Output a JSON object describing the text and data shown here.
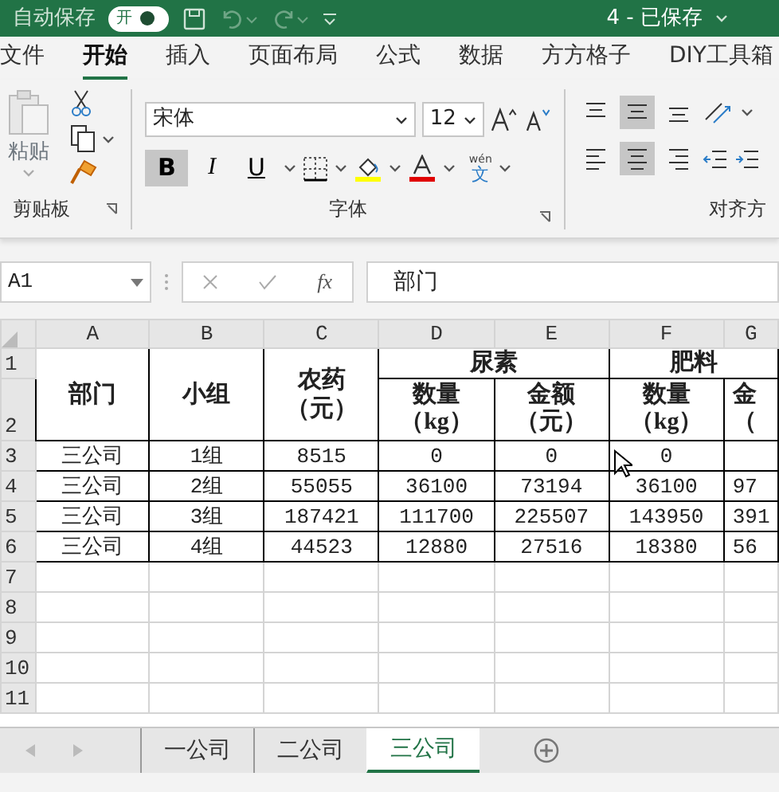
{
  "title_bar": {
    "autosave_label": "自动保存",
    "autosave_toggle": {
      "label": "开",
      "on": true
    },
    "document_title": "4 - 已保存"
  },
  "menu_tabs": [
    {
      "label": "文件",
      "selected": false
    },
    {
      "label": "开始",
      "selected": true
    },
    {
      "label": "插入",
      "selected": false
    },
    {
      "label": "页面布局",
      "selected": false
    },
    {
      "label": "公式",
      "selected": false
    },
    {
      "label": "数据",
      "selected": false
    },
    {
      "label": "方方格子",
      "selected": false
    },
    {
      "label": "DIY工具箱",
      "selected": false
    }
  ],
  "ribbon": {
    "clipboard": {
      "paste_label": "粘贴",
      "group_label": "剪贴板"
    },
    "font": {
      "font_name": "宋体",
      "font_size": "12",
      "pinyin_label": "wén",
      "pinyin_char": "文",
      "group_label": "字体",
      "style_buttons": [
        {
          "kind": "bold",
          "label": "B",
          "selected": true
        },
        {
          "kind": "italic",
          "label": "I",
          "selected": false
        },
        {
          "kind": "underline",
          "label": "U",
          "selected": false
        }
      ]
    },
    "alignment": {
      "group_label": "对齐方",
      "vertical": [
        {
          "kind": "top",
          "selected": false
        },
        {
          "kind": "middle",
          "selected": true
        },
        {
          "kind": "bottom",
          "selected": false
        }
      ],
      "horizontal": [
        {
          "kind": "left",
          "selected": false
        },
        {
          "kind": "center",
          "selected": true
        },
        {
          "kind": "right",
          "selected": false
        }
      ]
    }
  },
  "formula_bar": {
    "name_box": "A1",
    "fx": "fx",
    "formula": "部门"
  },
  "sheet": {
    "columns": [
      "A",
      "B",
      "C",
      "D",
      "E",
      "F",
      "G"
    ],
    "rows": [
      {
        "label": "1",
        "cells": [
          {
            "lines": [
              "部门"
            ],
            "rowspan": 2,
            "header": true
          },
          {
            "lines": [
              "小组"
            ],
            "rowspan": 2,
            "header": true
          },
          {
            "lines": [
              "农药",
              "（元）"
            ],
            "rowspan": 2,
            "header": true
          },
          {
            "lines": [
              "尿素"
            ],
            "colspan": 2,
            "header": true
          },
          {
            "lines": [
              "肥料"
            ],
            "colspan": 2,
            "header": true
          }
        ]
      },
      {
        "label": "2",
        "cells": [
          {
            "lines": [
              "数量",
              "（kg）"
            ],
            "header": true
          },
          {
            "lines": [
              "金额",
              "（元）"
            ],
            "header": true
          },
          {
            "lines": [
              "数量",
              "（kg）"
            ],
            "header": true
          },
          {
            "lines": [
              "金",
              "（"
            ],
            "header": true
          }
        ]
      },
      {
        "label": "3",
        "cells": [
          {
            "lines": [
              "三公司"
            ]
          },
          {
            "lines": [
              "1组"
            ]
          },
          {
            "lines": [
              "8515"
            ]
          },
          {
            "lines": [
              "0"
            ]
          },
          {
            "lines": [
              "0"
            ]
          },
          {
            "lines": [
              "0"
            ]
          },
          {}
        ]
      },
      {
        "label": "4",
        "cells": [
          {
            "lines": [
              "三公司"
            ]
          },
          {
            "lines": [
              "2组"
            ]
          },
          {
            "lines": [
              "55055"
            ]
          },
          {
            "lines": [
              "36100"
            ]
          },
          {
            "lines": [
              "73194"
            ]
          },
          {
            "lines": [
              "36100"
            ]
          },
          {
            "lines": [
              "97"
            ]
          }
        ]
      },
      {
        "label": "5",
        "cells": [
          {
            "lines": [
              "三公司"
            ]
          },
          {
            "lines": [
              "3组"
            ]
          },
          {
            "lines": [
              "187421"
            ]
          },
          {
            "lines": [
              "111700"
            ]
          },
          {
            "lines": [
              "225507"
            ]
          },
          {
            "lines": [
              "143950"
            ]
          },
          {
            "lines": [
              "391"
            ]
          }
        ]
      },
      {
        "label": "6",
        "cells": [
          {
            "lines": [
              "三公司"
            ]
          },
          {
            "lines": [
              "4组"
            ]
          },
          {
            "lines": [
              "44523"
            ]
          },
          {
            "lines": [
              "12880"
            ]
          },
          {
            "lines": [
              "27516"
            ]
          },
          {
            "lines": [
              "18380"
            ]
          },
          {
            "lines": [
              "56"
            ]
          }
        ]
      },
      {
        "label": "7",
        "cells": []
      },
      {
        "label": "8",
        "cells": []
      },
      {
        "label": "9",
        "cells": []
      },
      {
        "label": "10",
        "cells": []
      },
      {
        "label": "11",
        "cells": []
      }
    ]
  },
  "sheet_tabs": [
    {
      "label": "一公司",
      "selected": false
    },
    {
      "label": "二公司",
      "selected": false
    },
    {
      "label": "三公司",
      "selected": true
    }
  ]
}
